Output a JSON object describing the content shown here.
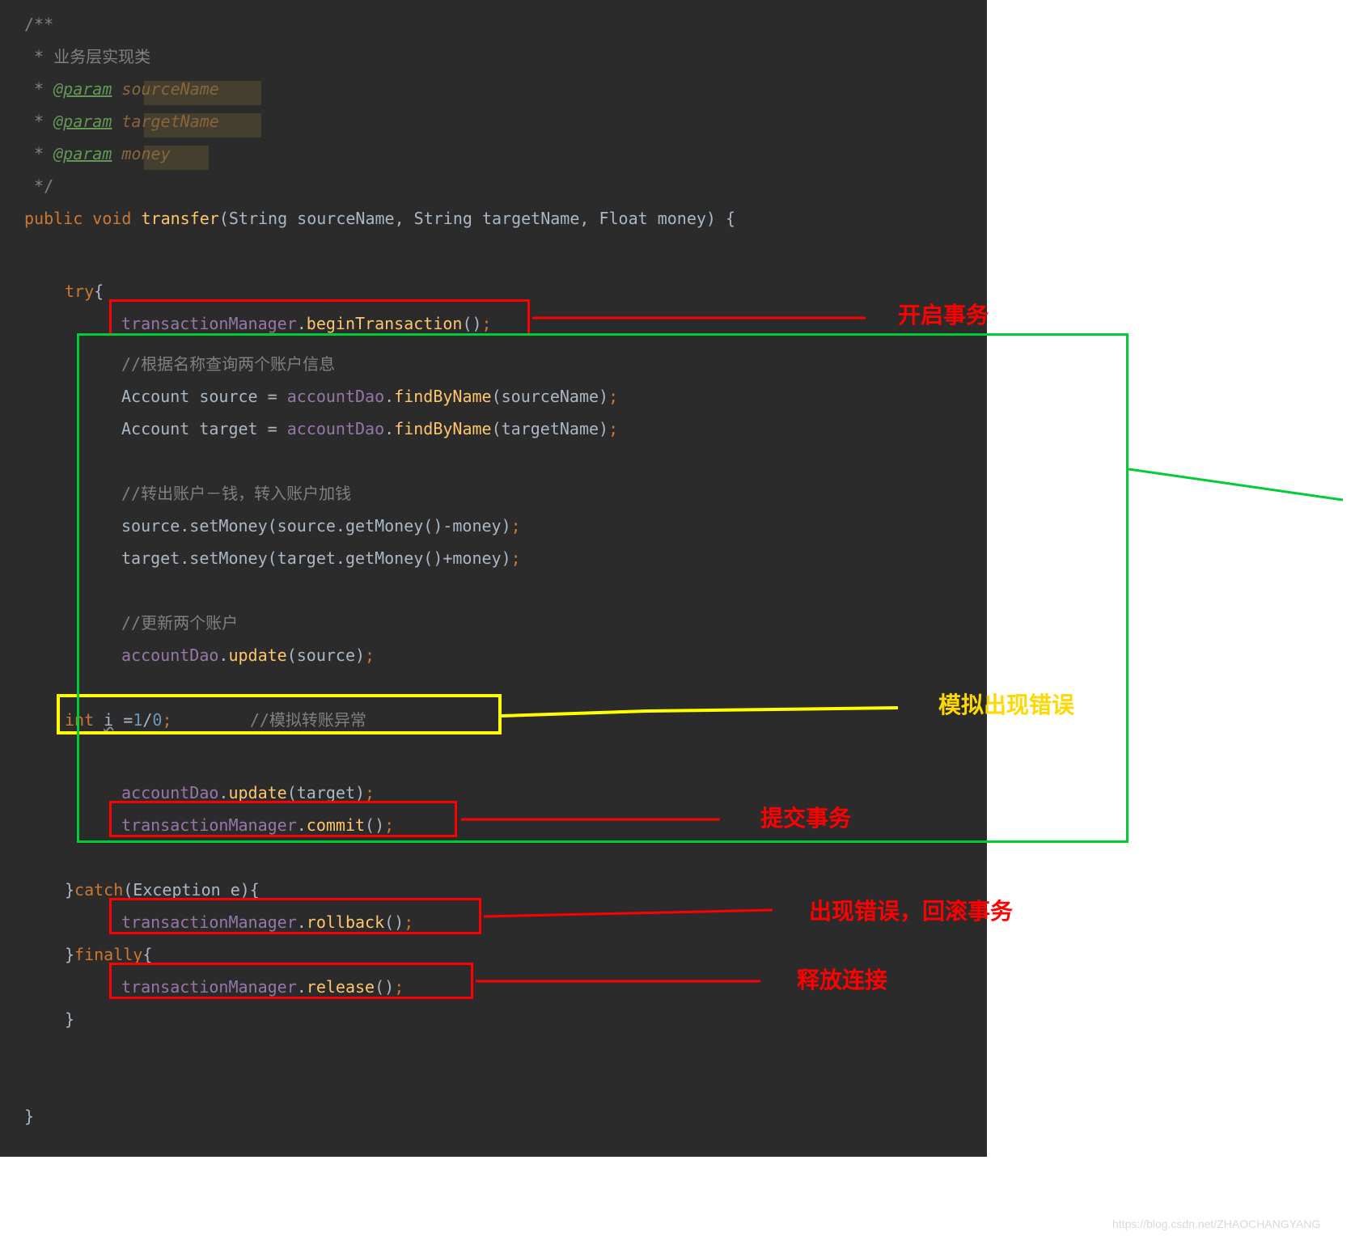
{
  "code": {
    "l1": "/**",
    "l2_a": " * ",
    "l2_b": "业务层实现类",
    "l3_a": " * ",
    "l3_tag": "@param",
    "l3_param": " sourceName",
    "l4_a": " * ",
    "l4_tag": "@param",
    "l4_param": " targetName",
    "l5_a": " * ",
    "l5_tag": "@param",
    "l5_param": " money",
    "l6": " */",
    "l7_kw1": "public ",
    "l7_kw2": "void ",
    "l7_name": "transfer",
    "l7_params": "(String sourceName, String targetName, Float money) {",
    "l9_try": "try",
    "l9_brace": "{",
    "l10_field": "transactionManager",
    "l10_dot": ".",
    "l10_method": "beginTransaction",
    "l10_end": "()",
    "l10_semi": ";",
    "l11_comment": "//根据名称查询两个账户信息",
    "l12_a": "Account source = ",
    "l12_field": "accountDao",
    "l12_dot": ".",
    "l12_method": "findByName",
    "l12_b": "(sourceName)",
    "l12_semi": ";",
    "l13_a": "Account target = ",
    "l13_field": "accountDao",
    "l13_dot": ".",
    "l13_method": "findByName",
    "l13_b": "(targetName)",
    "l13_semi": ";",
    "l15_comment": "//转出账户－钱，转入账户加钱",
    "l16_a": "source.setMoney(source.getMoney()-money)",
    "l16_semi": ";",
    "l17_a": "target.setMoney(target.getMoney()+money)",
    "l17_semi": ";",
    "l19_comment": "//更新两个账户",
    "l20_field": "accountDao",
    "l20_dot": ".",
    "l20_method": "update",
    "l20_b": "(source)",
    "l20_semi": ";",
    "l22_kw": "int ",
    "l22_var": "i",
    "l22_eq": " =",
    "l22_n1": "1",
    "l22_slash": "/",
    "l22_n2": "0",
    "l22_semi": ";",
    "l22_space": "        ",
    "l22_comment": "//模拟转账异常",
    "l24_field": "accountDao",
    "l24_dot": ".",
    "l24_method": "update",
    "l24_b": "(target)",
    "l24_semi": ";",
    "l25_field": "transactionManager",
    "l25_dot": ".",
    "l25_method": "commit",
    "l25_b": "()",
    "l25_semi": ";",
    "l27_brace": "}",
    "l27_catch": "catch",
    "l27_params": "(Exception e){",
    "l28_field": "transactionManager",
    "l28_dot": ".",
    "l28_method": "rollback",
    "l28_b": "()",
    "l28_semi": ";",
    "l29_brace": "}",
    "l29_finally": "finally",
    "l29_b": "{",
    "l30_field": "transactionManager",
    "l30_dot": ".",
    "l30_method": "release",
    "l30_b": "()",
    "l30_semi": ";",
    "l31_brace": "}",
    "l34_brace": "}"
  },
  "annotations": {
    "begin": "开启事务",
    "error": "模拟出现错误",
    "commit": "提交事务",
    "rollback": "出现错误，回滚事务",
    "release": "释放连接"
  },
  "watermark": "https://blog.csdn.net/ZHAOCHANGYANG"
}
